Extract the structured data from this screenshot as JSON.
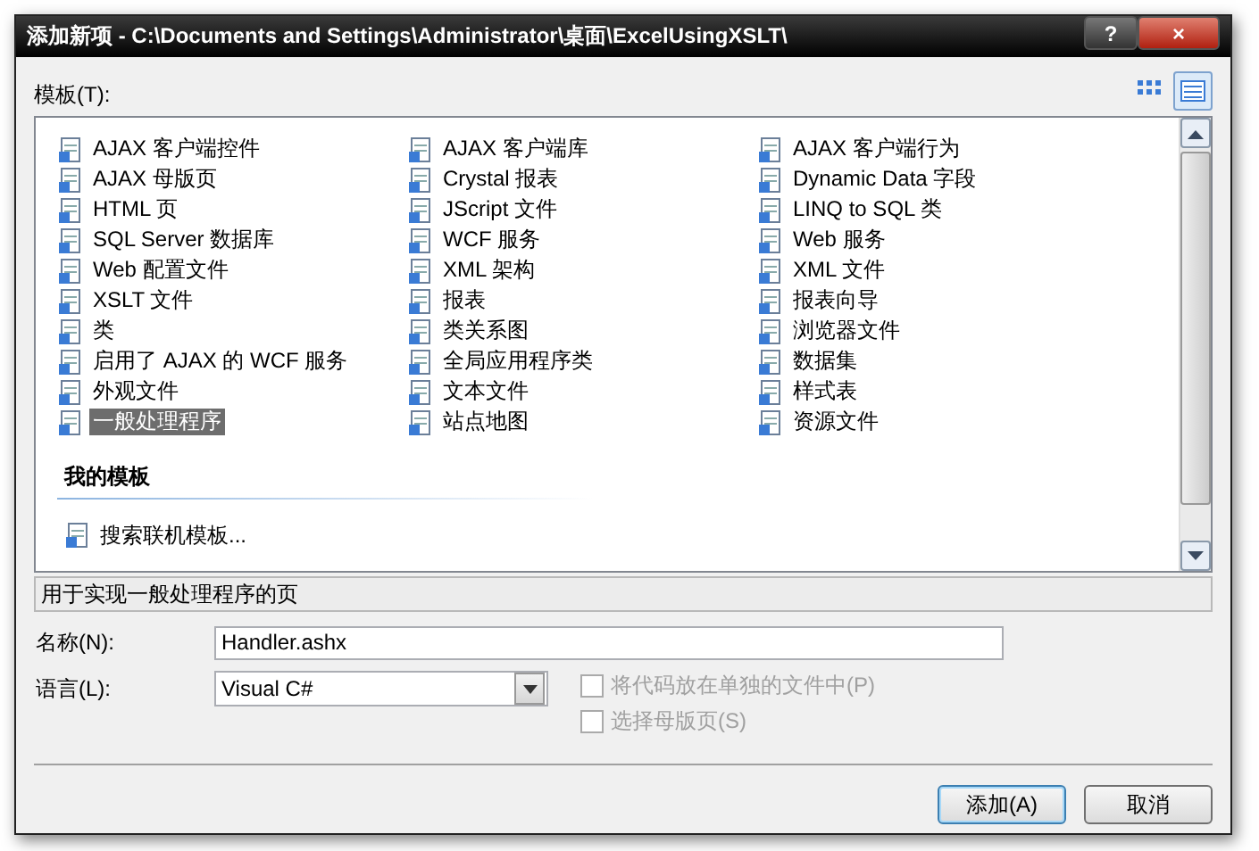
{
  "window": {
    "title": "添加新项 - C:\\Documents and Settings\\Administrator\\桌面\\ExcelUsingXSLT\\",
    "help_button": "?",
    "close_button": "×"
  },
  "templates_label": "模板(T):",
  "view_buttons": [
    {
      "kind": "icons",
      "selected": false
    },
    {
      "kind": "list",
      "selected": true
    }
  ],
  "templates": [
    {
      "label": "AJAX 客户端控件",
      "selected": false
    },
    {
      "label": "AJAX 客户端库",
      "selected": false
    },
    {
      "label": "AJAX 客户端行为",
      "selected": false
    },
    {
      "label": "AJAX 母版页",
      "selected": false
    },
    {
      "label": "Crystal 报表",
      "selected": false
    },
    {
      "label": "Dynamic Data 字段",
      "selected": false
    },
    {
      "label": "HTML 页",
      "selected": false
    },
    {
      "label": "JScript 文件",
      "selected": false
    },
    {
      "label": "LINQ to SQL 类",
      "selected": false
    },
    {
      "label": "SQL Server 数据库",
      "selected": false
    },
    {
      "label": "WCF 服务",
      "selected": false
    },
    {
      "label": "Web 服务",
      "selected": false
    },
    {
      "label": "Web 配置文件",
      "selected": false
    },
    {
      "label": "XML 架构",
      "selected": false
    },
    {
      "label": "XML 文件",
      "selected": false
    },
    {
      "label": "XSLT 文件",
      "selected": false
    },
    {
      "label": "报表",
      "selected": false
    },
    {
      "label": "报表向导",
      "selected": false
    },
    {
      "label": "类",
      "selected": false
    },
    {
      "label": "类关系图",
      "selected": false
    },
    {
      "label": "浏览器文件",
      "selected": false
    },
    {
      "label": "启用了 AJAX 的 WCF 服务",
      "selected": false
    },
    {
      "label": "全局应用程序类",
      "selected": false
    },
    {
      "label": "数据集",
      "selected": false
    },
    {
      "label": "外观文件",
      "selected": false
    },
    {
      "label": "文本文件",
      "selected": false
    },
    {
      "label": "样式表",
      "selected": false
    },
    {
      "label": "一般处理程序",
      "selected": true
    },
    {
      "label": "站点地图",
      "selected": false
    },
    {
      "label": "资源文件",
      "selected": false
    }
  ],
  "my_templates": {
    "heading": "我的模板",
    "items": [
      {
        "label": "搜索联机模板..."
      }
    ]
  },
  "description": "用于实现一般处理程序的页",
  "name_field": {
    "label": "名称(N):",
    "value": "Handler.ashx"
  },
  "language_field": {
    "label": "语言(L):",
    "value": "Visual C#"
  },
  "options": [
    {
      "label": "将代码放在单独的文件中(P)",
      "checked": false,
      "disabled": true
    },
    {
      "label": "选择母版页(S)",
      "checked": false,
      "disabled": true
    }
  ],
  "buttons": [
    {
      "label": "添加(A)",
      "default": true
    },
    {
      "label": "取消",
      "default": false
    }
  ]
}
